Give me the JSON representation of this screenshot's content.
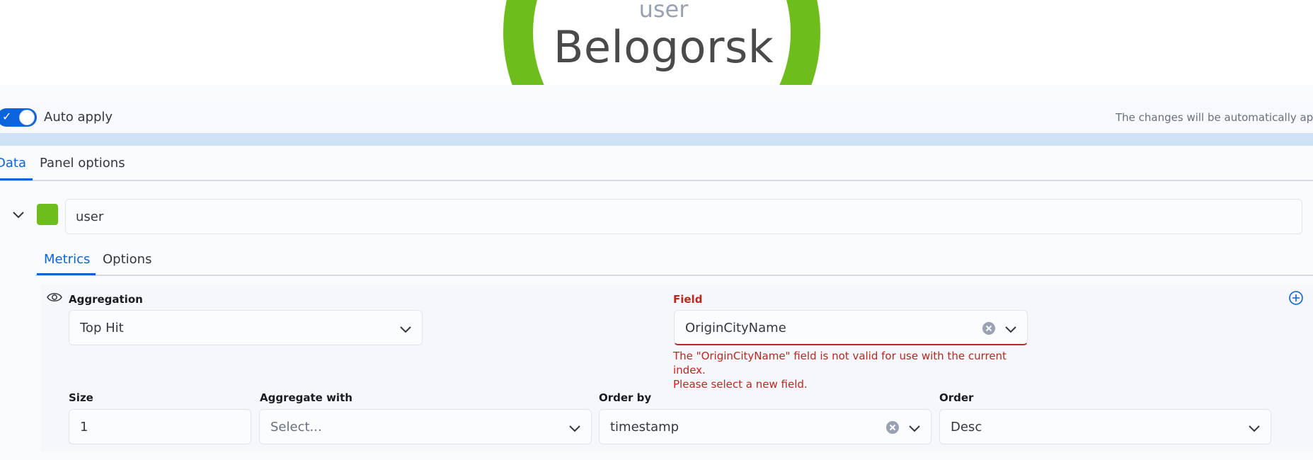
{
  "preview": {
    "label": "user",
    "value": "Belogorsk",
    "gauge_color": "#6dbd1d"
  },
  "auto_apply": {
    "label": "Auto apply",
    "enabled": true,
    "note": "The changes will be automatically appli"
  },
  "main_tabs": [
    {
      "label": "Data",
      "active": true
    },
    {
      "label": "Panel options",
      "active": false
    }
  ],
  "series": {
    "color": "#6dbd1d",
    "label_value": "user"
  },
  "sub_tabs": [
    {
      "label": "Metrics",
      "active": true
    },
    {
      "label": "Options",
      "active": false
    }
  ],
  "metric": {
    "aggregation_label": "Aggregation",
    "aggregation_value": "Top Hit",
    "field_label": "Field",
    "field_value": "OriginCityName",
    "field_error_line1": "The \"OriginCityName\" field is not valid for use with the current index.",
    "field_error_line2": "Please select a new field.",
    "size_label": "Size",
    "size_value": "1",
    "aggregate_with_label": "Aggregate with",
    "aggregate_with_placeholder": "Select...",
    "order_by_label": "Order by",
    "order_by_value": "timestamp",
    "order_label": "Order",
    "order_value": "Desc"
  },
  "colors": {
    "accent": "#0b64dd",
    "error": "#bd271e"
  }
}
